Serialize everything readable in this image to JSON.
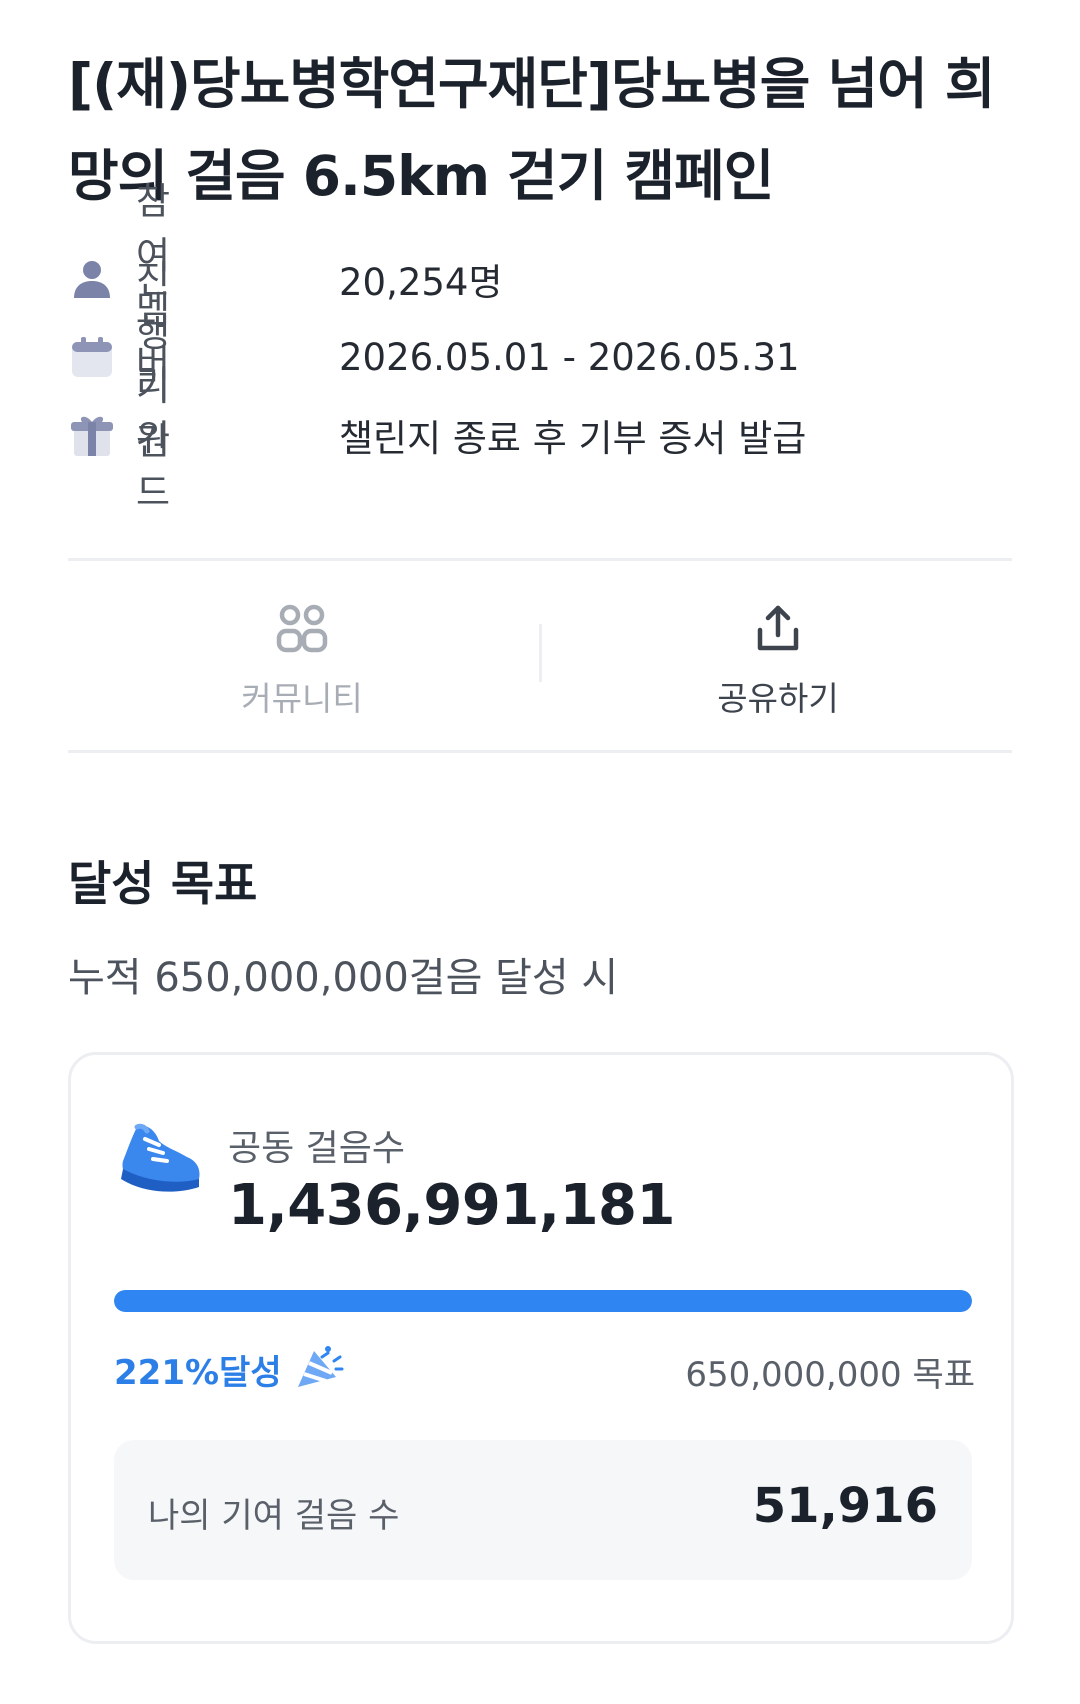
{
  "campaign": {
    "title": "[(재)당뇨병학연구재단]당뇨병을 넘어 희망의 걸음 6.5km 걷기 캠페인"
  },
  "info": [
    {
      "icon": "person-icon",
      "label": "참여 멤버",
      "value": "20,254명"
    },
    {
      "icon": "calendar-icon",
      "label": "진행 기간",
      "value": "2026.05.01 - 2026.05.31"
    },
    {
      "icon": "gift-icon",
      "label": "리워드",
      "value": "챌린지 종료 후 기부 증서 발급"
    }
  ],
  "actions": {
    "community": {
      "icon": "community-icon",
      "label": "커뮤니티"
    },
    "share": {
      "icon": "share-icon",
      "label": "공유하기"
    }
  },
  "goal": {
    "title": "달성 목표",
    "subtitle": "누적 650,000,000걸음 달성 시"
  },
  "steps_card": {
    "icon": "sneaker-icon",
    "label": "공동 걸음수",
    "total": "1,436,991,181",
    "progress_fraction": 1.0,
    "achieved": "221%달성",
    "achieved_icon": "party-popper-icon",
    "goal_text": "650,000,000 목표",
    "my_label": "나의 기여 걸음 수",
    "my_value": "51,916"
  },
  "colors": {
    "accent": "#2f86f2",
    "icon_purple": "#7b83a8",
    "text_dark": "#1c222c",
    "text_muted": "#5a6069"
  }
}
